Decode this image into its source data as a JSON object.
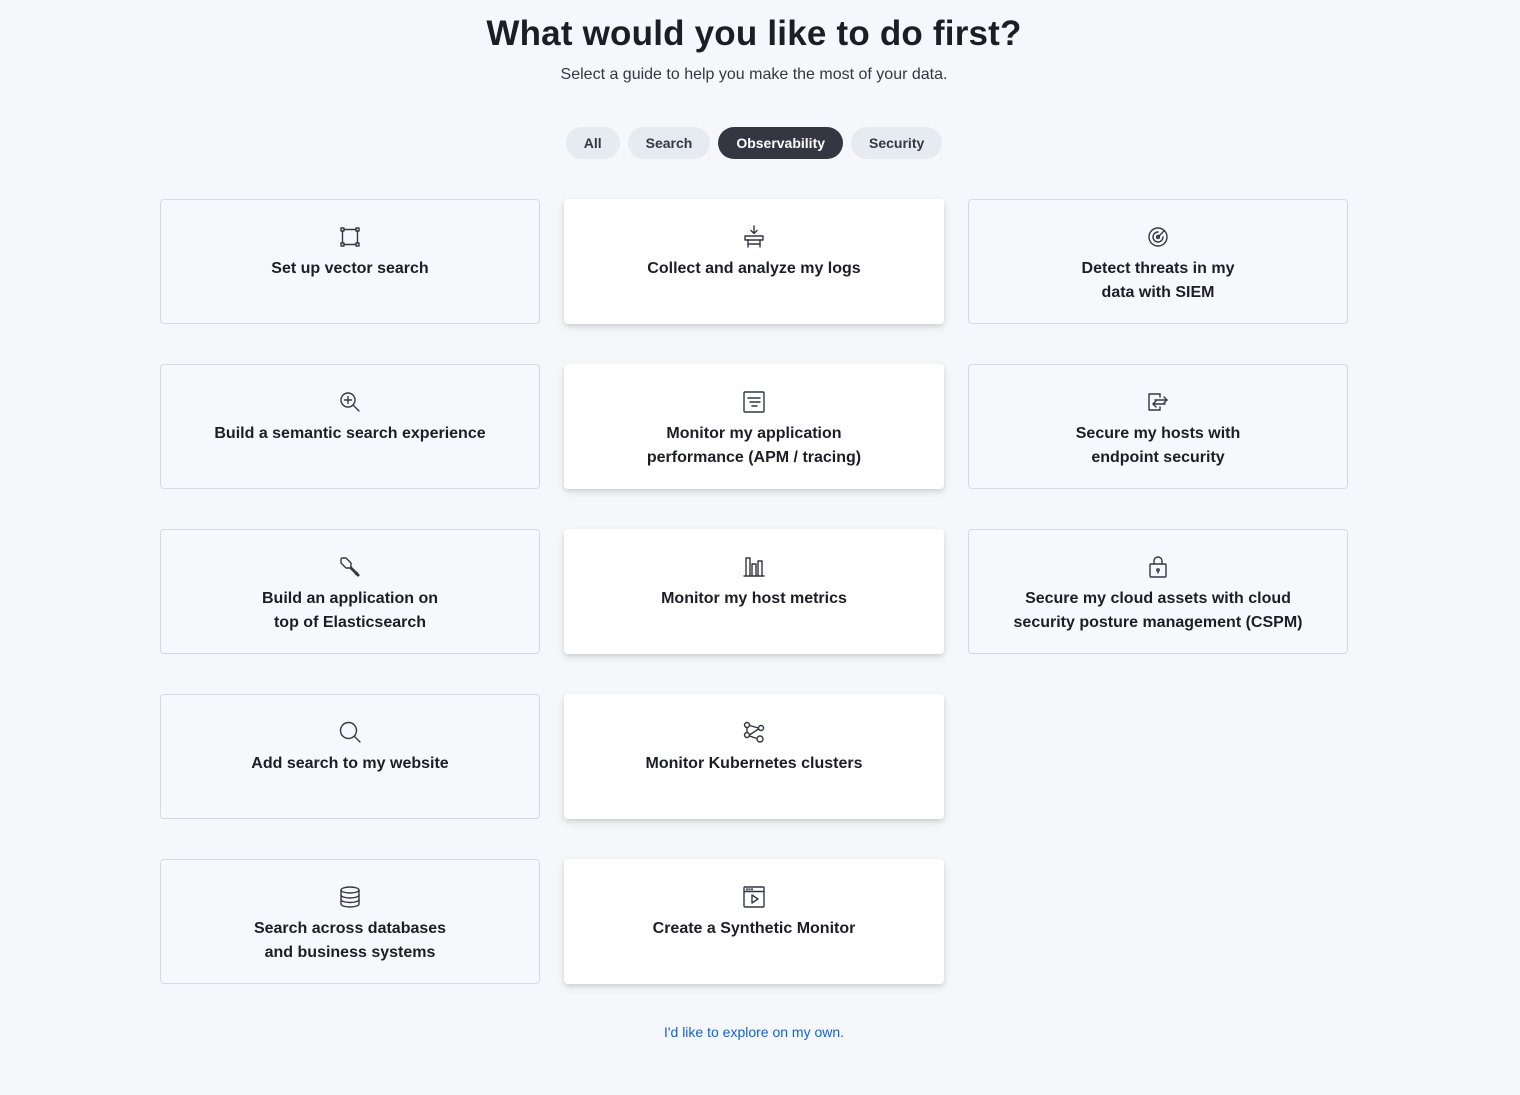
{
  "header": {
    "title": "What would you like to do first?",
    "subtitle": "Select a guide to help you make the most of your data."
  },
  "filters": [
    {
      "label": "All",
      "active": false
    },
    {
      "label": "Search",
      "active": false
    },
    {
      "label": "Observability",
      "active": true
    },
    {
      "label": "Security",
      "active": false
    }
  ],
  "cards": {
    "vector_search": {
      "label": "Set up vector search",
      "icon": "vector-icon"
    },
    "collect_logs": {
      "label": "Collect and analyze my logs",
      "icon": "logs-icon"
    },
    "detect_threats": {
      "label": "Detect threats in my\ndata with SIEM",
      "icon": "radar-icon"
    },
    "semantic_search": {
      "label": "Build a semantic search experience",
      "icon": "magnify-plus-icon"
    },
    "apm": {
      "label": "Monitor my application\nperformance (APM / tracing)",
      "icon": "apm-document-icon"
    },
    "endpoint_security": {
      "label": "Secure my hosts with\nendpoint security",
      "icon": "endpoint-icon"
    },
    "build_app": {
      "label": "Build an application on\ntop of Elasticsearch",
      "icon": "wrench-icon"
    },
    "host_metrics": {
      "label": "Monitor my host metrics",
      "icon": "metrics-icon"
    },
    "cspm": {
      "label": "Secure my cloud assets with cloud\nsecurity posture management (CSPM)",
      "icon": "lock-icon"
    },
    "website_search": {
      "label": "Add search to my website",
      "icon": "search-icon"
    },
    "kubernetes": {
      "label": "Monitor Kubernetes clusters",
      "icon": "cluster-icon"
    },
    "databases": {
      "label": "Search across databases\nand business systems",
      "icon": "database-icon"
    },
    "synthetic": {
      "label": "Create a Synthetic Monitor",
      "icon": "synthetic-play-icon"
    }
  },
  "explore_link": "I'd like to explore on my own."
}
